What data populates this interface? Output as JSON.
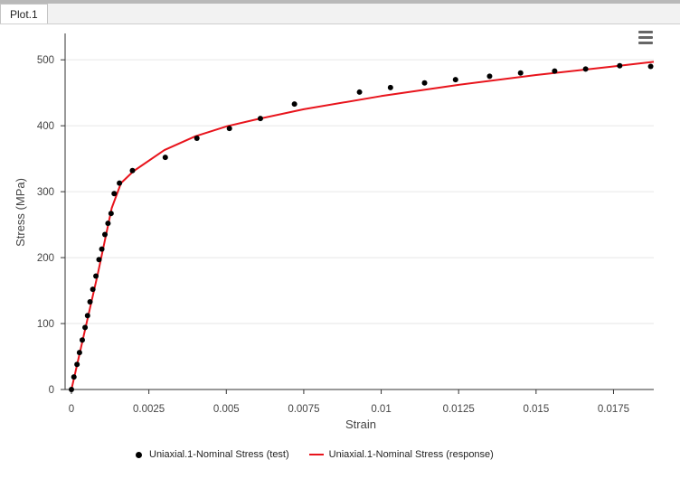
{
  "tab": {
    "label": "Plot.1"
  },
  "chart_data": {
    "type": "scatter",
    "xlabel": "Strain",
    "ylabel": "Stress (MPa)",
    "xlim": [
      0,
      0.0188
    ],
    "ylim": [
      0,
      540
    ],
    "xticks": [
      0,
      0.0025,
      0.005,
      0.0075,
      0.01,
      0.0125,
      0.015,
      0.0175
    ],
    "xtick_labels": [
      "0",
      "0.0025",
      "0.005",
      "0.0075",
      "0.01",
      "0.0125",
      "0.015",
      "0.0175"
    ],
    "yticks": [
      0,
      100,
      200,
      300,
      400,
      500
    ],
    "ytick_labels": [
      "0",
      "100",
      "200",
      "300",
      "400",
      "500"
    ],
    "grid": true,
    "legend_position": "bottom",
    "series": [
      {
        "name": "Uniaxial.1-Nominal Stress (test)",
        "kind": "scatter",
        "color": "#000000",
        "x": [
          0,
          8e-05,
          0.00018,
          0.00026,
          0.00035,
          0.00044,
          0.00052,
          0.0006,
          0.00069,
          0.00079,
          0.00089,
          0.00098,
          0.00108,
          0.00118,
          0.00128,
          0.00138,
          0.00155,
          0.00197,
          0.00303,
          0.00405,
          0.0051,
          0.0061,
          0.0072,
          0.0093,
          0.0103,
          0.0114,
          0.0124,
          0.0135,
          0.0145,
          0.0156,
          0.0166,
          0.0177,
          0.0187
        ],
        "y": [
          0,
          19,
          38,
          56,
          75,
          94,
          112,
          133,
          152,
          172,
          197,
          213,
          235,
          252,
          267,
          297,
          313,
          332,
          352,
          381,
          396,
          411,
          433,
          451,
          458,
          465,
          470,
          475,
          480,
          483,
          486,
          491,
          490
        ]
      },
      {
        "name": "Uniaxial.1-Nominal Stress (response)",
        "kind": "line",
        "color": "#e8141c",
        "x": [
          0,
          0.00085,
          0.0013,
          0.0016,
          0.002,
          0.003,
          0.004,
          0.005,
          0.006,
          0.0075,
          0.01,
          0.0125,
          0.015,
          0.0175,
          0.0188
        ],
        "y": [
          0,
          175,
          275,
          313,
          331,
          363,
          384,
          399,
          410,
          425,
          445,
          462,
          477,
          490,
          497
        ]
      }
    ]
  }
}
